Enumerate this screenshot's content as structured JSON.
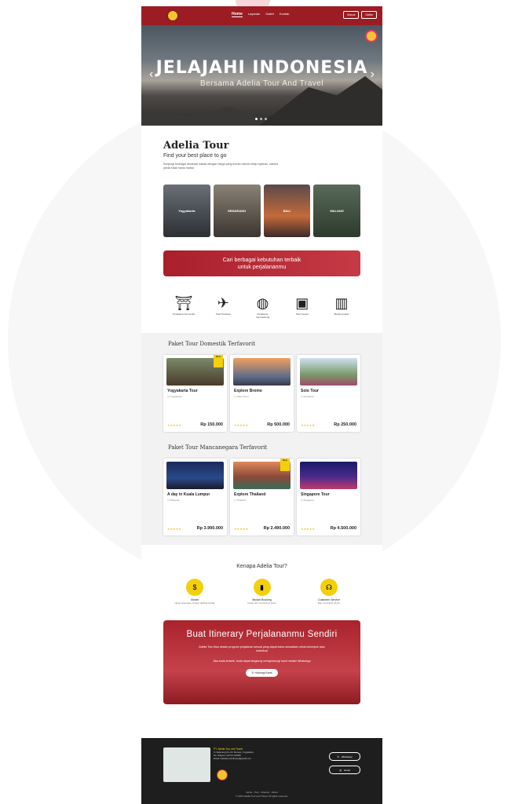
{
  "nav": {
    "links": [
      "Home",
      "Layanan",
      "Galeri",
      "Kontak"
    ],
    "buttons": [
      "Masuk",
      "Daftar"
    ]
  },
  "hero": {
    "title": "JELAJAHI INDONESIA",
    "subtitle": "Bersama Adelia Tour And Travel"
  },
  "intro": {
    "brand": "Adelia Tour",
    "tagline": "Find your best place to go",
    "description": "Kunjungi berbagai destinasi wisata dengan harga yang murah namun tetap nyaman, karena piknik tidak harus mahal."
  },
  "cities": [
    "Yogyakarta",
    "SEMARANG",
    "BALI",
    "MALANG"
  ],
  "cta": {
    "line1": "Cari berbagai kebutuhan terbaik",
    "line2": "untuk perjalananmu"
  },
  "services": [
    "Perjalanan Domestik",
    "Tiket Pesawat",
    "Perjalanan Internasional",
    "Tiket Kereta",
    "Booking Hotel"
  ],
  "domestic": {
    "title": "Paket Tour Domestik Terfavorit",
    "cards": [
      {
        "name": "Yogyakarta Tour",
        "loc": "Yogyakarta",
        "price": "Rp 150.000",
        "badge": "Best"
      },
      {
        "name": "Explore Bromo",
        "loc": "Jawa Timur",
        "price": "Rp 500.000",
        "badge": ""
      },
      {
        "name": "Solo Tour",
        "loc": "Surakarta",
        "price": "Rp 250.000",
        "badge": ""
      }
    ]
  },
  "international": {
    "title": "Paket Tour Mancanegara Terfavorit",
    "cards": [
      {
        "name": "A day in Kuala Lumpur",
        "loc": "Malaysia",
        "price": "Rp 3.990.000",
        "badge": ""
      },
      {
        "name": "Explore Thailand",
        "loc": "Thailand",
        "price": "Rp 2.490.000",
        "badge": "Best"
      },
      {
        "name": "Singapore Tour",
        "loc": "Singapore",
        "price": "Rp 4.500.000",
        "badge": ""
      }
    ]
  },
  "why": {
    "title": "Kenapa Adelia Tour?",
    "items": [
      {
        "t": "Murah",
        "d": "Harga terjangkau dengan fasilitas terbaik"
      },
      {
        "t": "Mudah Booking",
        "d": "Cukup dari smartphone kamu"
      },
      {
        "t": "Customer Service",
        "d": "Siap membantu 24 jam"
      }
    ]
  },
  "itinerary": {
    "title": "Buat Itinerary Perjalananmu Sendiri",
    "p1": "Adelia Tour bisa desain program perjalanan sesuai yang dapat kamu sesuaikan untuk kelompok atau individual",
    "p2": "Jika anda tertarik, anda dapat langsung menghubungi kami melalui WhatsApp",
    "button": "Hubungi Kami"
  },
  "footer": {
    "company": "PT. Adelia Tour and Travel",
    "address": "Jl. Kaliurang Km 10, Sleman, Yogyakarta",
    "phone": "No. Telepon: (0274) 123456",
    "email": "Email: adeliatourandtravel@gmail.com",
    "btn_wa": "WhatsApp",
    "btn_mail": "Email",
    "links": "Home · Tour · Itinerary · About",
    "copyright": "© 2021 Adelia Tour and Travel. All rights reserved."
  }
}
